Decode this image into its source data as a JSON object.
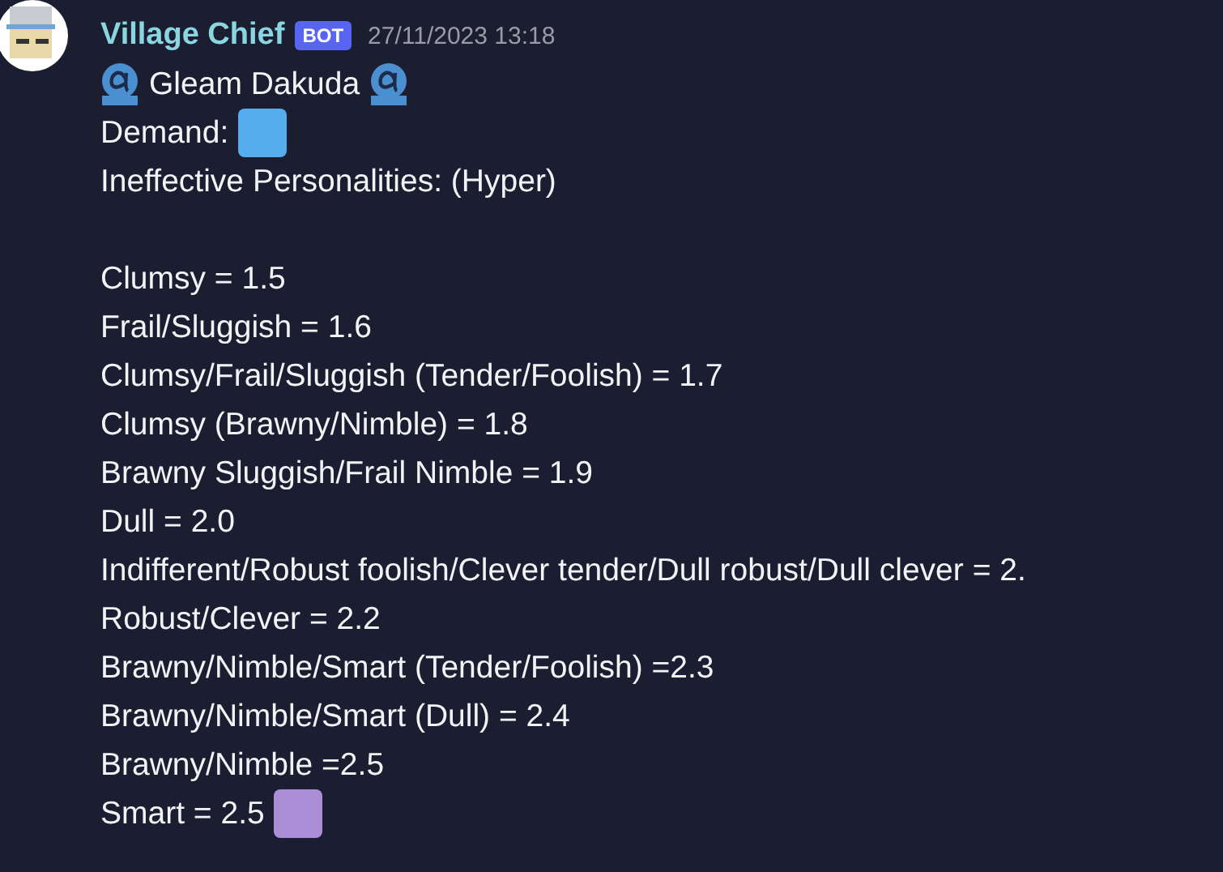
{
  "message": {
    "author": "Village Chief",
    "badge": "BOT",
    "timestamp": "27/11/2023 13:18",
    "title": "Gleam Dakuda",
    "demand": {
      "label": "Demand:",
      "color": "#55acee"
    },
    "note": "Ineffective Personalities: (Hyper)",
    "ratings": [
      {
        "text": "Clumsy = 1.5"
      },
      {
        "text": "Frail/Sluggish = 1.6"
      },
      {
        "text": "Clumsy/Frail/Sluggish (Tender/Foolish) = 1.7"
      },
      {
        "text": "Clumsy (Brawny/Nimble) = 1.8"
      },
      {
        "text": "Brawny Sluggish/Frail Nimble = 1.9"
      },
      {
        "text": "Dull = 2.0"
      },
      {
        "text": "Indifferent/Robust foolish/Clever tender/Dull robust/Dull clever = 2."
      },
      {
        "text": "Robust/Clever = 2.2"
      },
      {
        "text": "Brawny/Nimble/Smart (Tender/Foolish) =2.3"
      },
      {
        "text": "Brawny/Nimble/Smart (Dull) = 2.4"
      },
      {
        "text": "Brawny/Nimble =2.5"
      },
      {
        "text": "Smart = 2.5",
        "color": "#aa8ed6"
      }
    ]
  }
}
